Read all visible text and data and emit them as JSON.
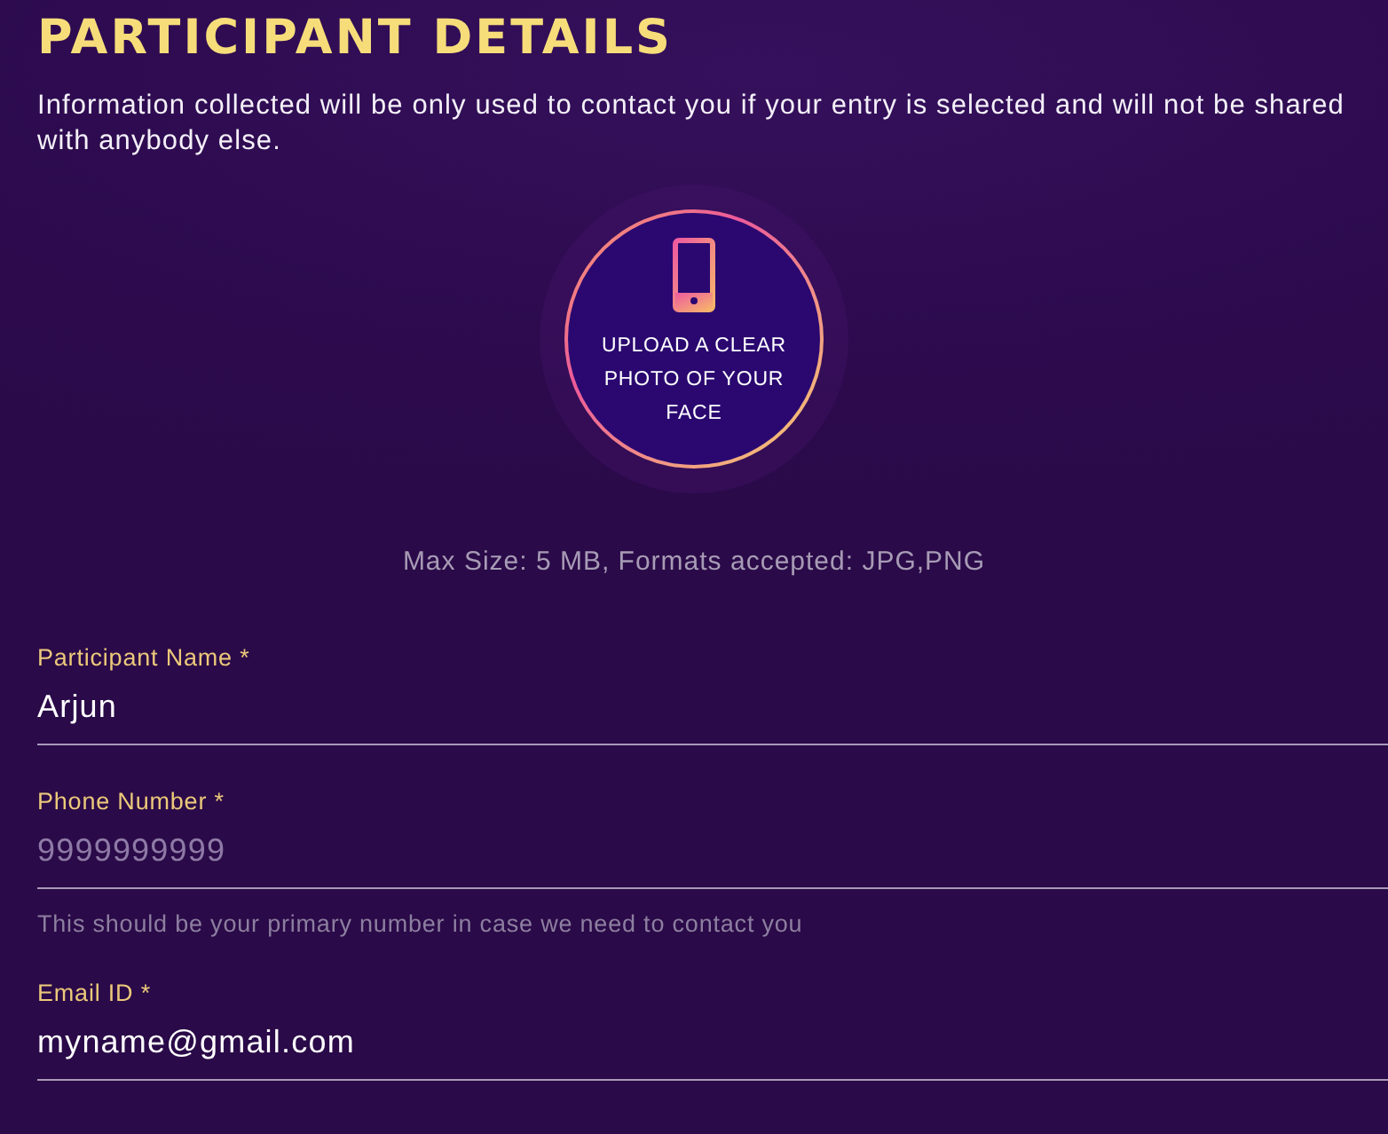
{
  "title": "PARTICIPANT DETAILS",
  "intro": "Information collected will be only used to contact you if your entry is selected and will not be shared with anybody else.",
  "upload": {
    "label": "UPLOAD A CLEAR PHOTO OF YOUR FACE",
    "note": "Max Size: 5 MB, Formats accepted: JPG,PNG"
  },
  "fields": [
    {
      "label": "Participant Name *",
      "value": "Arjun"
    },
    {
      "label": "Phone Number *",
      "placeholder": "9999999999",
      "hint": "This should be your primary number in case we need to contact you"
    },
    {
      "label": "Email ID *",
      "value": "myname@gmail.com"
    }
  ]
}
